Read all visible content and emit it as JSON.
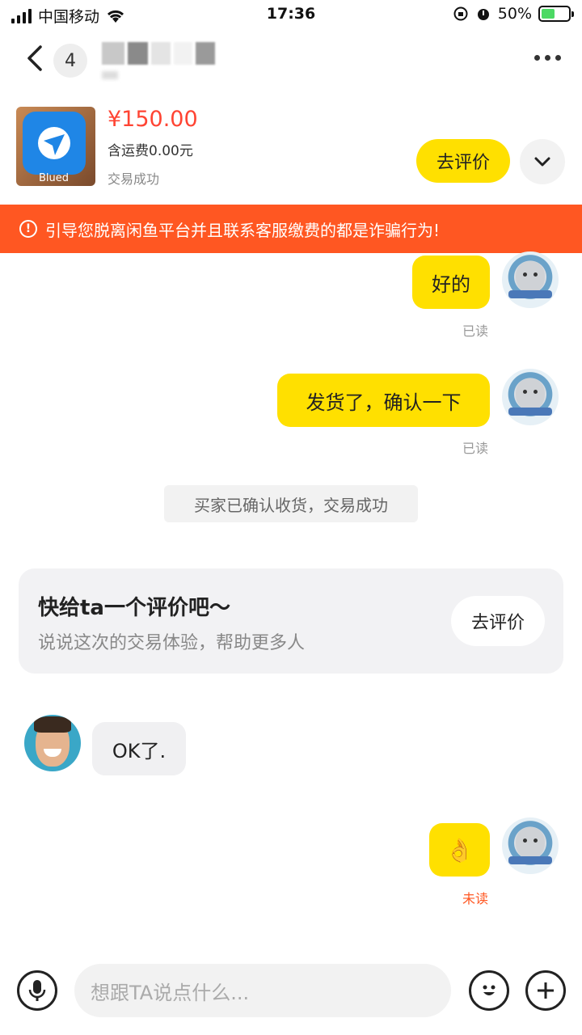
{
  "status_bar": {
    "carrier": "中国移动",
    "time": "17:36",
    "battery": "50%"
  },
  "nav": {
    "unread_count": "4"
  },
  "product": {
    "price": "¥150.00",
    "shipping": "含运费0.00元",
    "status": "交易成功",
    "image_label": "Blued",
    "review_button": "去评价"
  },
  "warning": {
    "text": "引导您脱离闲鱼平台并且联系客服缴费的都是诈骗行为!"
  },
  "messages": [
    {
      "sender": "me",
      "text": "好的",
      "read_status": "已读"
    },
    {
      "sender": "me",
      "text": "发货了，确认一下",
      "read_status": "已读"
    },
    {
      "sender": "me",
      "text": "👌",
      "read_status": "未读"
    },
    {
      "sender": "them",
      "text": "OK了."
    }
  ],
  "system_message": "买家已确认收货，交易成功",
  "review_card": {
    "title": "快给ta一个评价吧～",
    "subtitle": "说说这次的交易体验，帮助更多人",
    "button": "去评价"
  },
  "input": {
    "placeholder": "想跟TA说点什么..."
  },
  "colors": {
    "accent_yellow": "#ffe000",
    "warning_orange": "#ff5722",
    "price_red": "#ff4433"
  }
}
